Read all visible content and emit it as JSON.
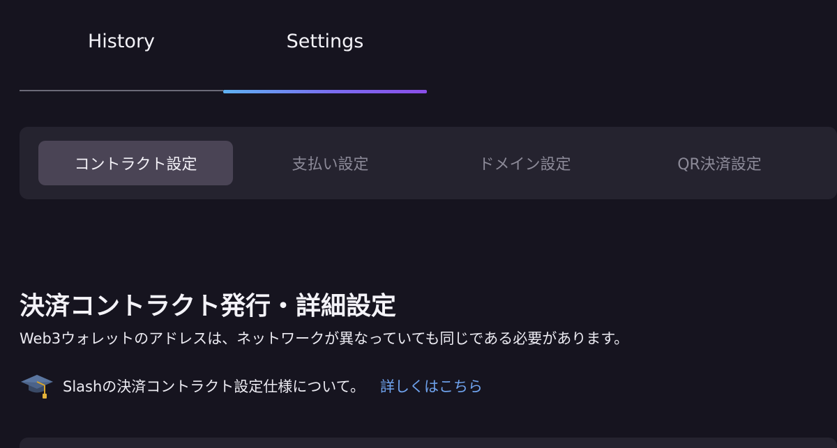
{
  "tabs": {
    "history_label": "History",
    "settings_label": "Settings",
    "active": "Settings"
  },
  "segments": [
    {
      "label": "コントラクト設定",
      "active": true
    },
    {
      "label": "支払い設定",
      "active": false
    },
    {
      "label": "ドメイン設定",
      "active": false
    },
    {
      "label": "QR決済設定",
      "active": false
    }
  ],
  "content": {
    "title": "決済コントラクト発行・詳細設定",
    "subtitle": "Web3ウォレットのアドレスは、ネットワークが異なっていても同じである必要があります。",
    "info_icon": "graduation-cap-icon",
    "info_text": "Slashの決済コントラクト設定仕様について。",
    "info_link": "詳しくはこちら"
  },
  "colors": {
    "background": "#16141f",
    "panel": "#25232f",
    "active_segment": "#4a4455",
    "link": "#6fa3ee",
    "tab_gradient": [
      "#5fb2f2",
      "#7b6cf0",
      "#8a4ee8"
    ]
  }
}
